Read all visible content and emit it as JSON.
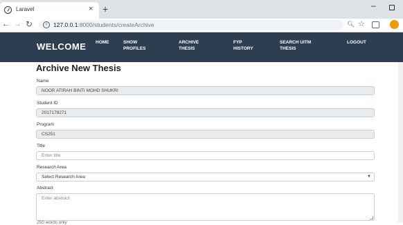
{
  "browser": {
    "tab_title": "Laravel",
    "tab_close": "×",
    "new_tab": "+",
    "url_host": "127.0.0.1",
    "url_rest": ":8000/students/createArchive",
    "win_min": "–"
  },
  "nav": {
    "brand": "WELCOME",
    "links": [
      {
        "line1": "HOME",
        "line2": ""
      },
      {
        "line1": "SHOW",
        "line2": "PROFILES"
      },
      {
        "line1": "ARCHIVE",
        "line2": "THESIS"
      },
      {
        "line1": "FYP",
        "line2": "HISTORY"
      },
      {
        "line1": "SEARCH UITM",
        "line2": "THESIS"
      },
      {
        "line1": "LOGOUT",
        "line2": ""
      }
    ]
  },
  "form": {
    "title": "Archive New Thesis",
    "name": {
      "label": "Name",
      "value": "NOOR ATIRAH BINTI MOHD SHUKRI"
    },
    "student_id": {
      "label": "Student ID",
      "value": "2017178271"
    },
    "program": {
      "label": "Program",
      "value": "CS251"
    },
    "thesis_title": {
      "label": "Title",
      "placeholder": "Enter title"
    },
    "research_area": {
      "label": "Research Area",
      "selected": "Select Research Area"
    },
    "abstract": {
      "label": "Abstract",
      "placeholder": "Enter abstract"
    },
    "hint": "250 words only"
  },
  "icons": {
    "favicon": "globe-icon",
    "back": "arrow-left-icon",
    "forward": "arrow-right-icon",
    "reload": "reload-icon",
    "info": "info-icon",
    "zoom": "zoom-icon",
    "bookmark": "star-icon",
    "extension": "extension-icon",
    "profile": "profile-icon",
    "dropdown": "chevron-down-icon"
  },
  "colors": {
    "nav_bg": "#2c3e50",
    "profile": "#f29900"
  }
}
